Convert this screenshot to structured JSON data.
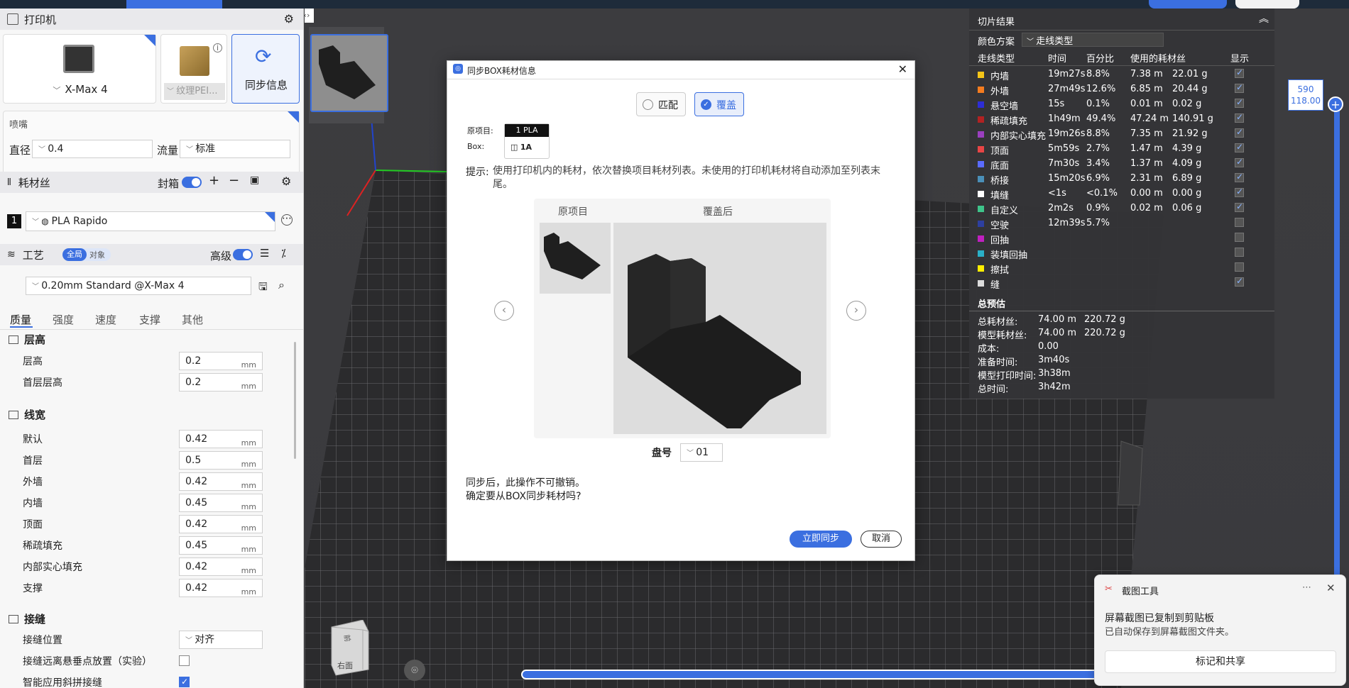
{
  "printer": {
    "title": "打印机",
    "model": "X-Max 4",
    "plate": "纹理PEI...",
    "sync_label": "同步信息"
  },
  "nozzle": {
    "title": "喷嘴",
    "diameter_label": "直径",
    "diameter_value": "0.4",
    "flow_label": "流量",
    "flow_value": "标准"
  },
  "filament": {
    "title": "耗材丝",
    "enclosure_label": "封箱",
    "slot": "1",
    "name": "PLA Rapido"
  },
  "process": {
    "title": "工艺",
    "global_label": "全局",
    "object_label": "对象",
    "advanced_label": "高级",
    "preset": "0.20mm Standard @X-Max 4",
    "tabs": [
      "质量",
      "强度",
      "速度",
      "支撑",
      "其他"
    ]
  },
  "quality": {
    "layer_group": "层高",
    "layer_height_label": "层高",
    "layer_height": "0.2",
    "first_layer_label": "首层层高",
    "first_layer": "0.2",
    "unit": "mm",
    "line_group": "线宽",
    "lines": [
      {
        "label": "默认",
        "value": "0.42"
      },
      {
        "label": "首层",
        "value": "0.5"
      },
      {
        "label": "外墙",
        "value": "0.42"
      },
      {
        "label": "内墙",
        "value": "0.45"
      },
      {
        "label": "顶面",
        "value": "0.42"
      },
      {
        "label": "稀疏填充",
        "value": "0.45"
      },
      {
        "label": "内部实心填充",
        "value": "0.42"
      },
      {
        "label": "支撑",
        "value": "0.42"
      }
    ],
    "seam_group": "接缝",
    "seam_pos_label": "接缝位置",
    "seam_pos_value": "对齐",
    "seam_far_label": "接缝远离悬垂点放置（实验）",
    "seam_scarf_label": "智能应用斜拼接缝"
  },
  "results": {
    "title": "切片结果",
    "scheme_label": "颜色方案",
    "scheme_value": "走线类型",
    "headers": [
      "走线类型",
      "时间",
      "百分比",
      "使用的耗材丝",
      "显示"
    ],
    "rows": [
      {
        "name": "内墙",
        "time": "19m27s",
        "pct": "8.8%",
        "len": "7.38 m",
        "wt": "22.01 g",
        "color": "#f5c518",
        "shown": true
      },
      {
        "name": "外墙",
        "time": "27m49s",
        "pct": "12.6%",
        "len": "6.85 m",
        "wt": "20.44 g",
        "color": "#f57c1f",
        "shown": true
      },
      {
        "name": "悬空墙",
        "time": "15s",
        "pct": "0.1%",
        "len": "0.01 m",
        "wt": "0.02 g",
        "color": "#2d2dd6",
        "shown": true
      },
      {
        "name": "稀疏填充",
        "time": "1h49m",
        "pct": "49.4%",
        "len": "47.24 m",
        "wt": "140.91 g",
        "color": "#b22222",
        "shown": true
      },
      {
        "name": "内部实心填充",
        "time": "19m26s",
        "pct": "8.8%",
        "len": "7.35 m",
        "wt": "21.92 g",
        "color": "#9b3fbf",
        "shown": true
      },
      {
        "name": "顶面",
        "time": "5m59s",
        "pct": "2.7%",
        "len": "1.47 m",
        "wt": "4.39 g",
        "color": "#e84545",
        "shown": true
      },
      {
        "name": "底面",
        "time": "7m30s",
        "pct": "3.4%",
        "len": "1.37 m",
        "wt": "4.09 g",
        "color": "#5a6bff",
        "shown": true
      },
      {
        "name": "桥接",
        "time": "15m20s",
        "pct": "6.9%",
        "len": "2.31 m",
        "wt": "6.89 g",
        "color": "#4a8fb8",
        "shown": true
      },
      {
        "name": "填缝",
        "time": "<1s",
        "pct": "<0.1%",
        "len": "0.00 m",
        "wt": "0.00 g",
        "color": "#ffffff",
        "shown": true
      },
      {
        "name": "自定义",
        "time": "2m2s",
        "pct": "0.9%",
        "len": "0.02 m",
        "wt": "0.06 g",
        "color": "#3ec48a",
        "shown": true
      },
      {
        "name": "空驶",
        "time": "12m39s",
        "pct": "5.7%",
        "len": "",
        "wt": "",
        "color": "#2d3fa0",
        "shown": false
      },
      {
        "name": "回抽",
        "time": "",
        "pct": "",
        "len": "",
        "wt": "",
        "color": "#c020c0",
        "shown": false
      },
      {
        "name": "装填回抽",
        "time": "",
        "pct": "",
        "len": "",
        "wt": "",
        "color": "#2ab0c8",
        "shown": false
      },
      {
        "name": "擦拭",
        "time": "",
        "pct": "",
        "len": "",
        "wt": "",
        "color": "#ffee00",
        "shown": false
      },
      {
        "name": "缝",
        "time": "",
        "pct": "",
        "len": "",
        "wt": "",
        "color": "#dddddd",
        "shown": true
      }
    ],
    "summary_title": "总预估",
    "summary": [
      {
        "label": "总耗材丝:",
        "v1": "74.00 m",
        "v2": "220.72 g"
      },
      {
        "label": "模型耗材丝:",
        "v1": "74.00 m",
        "v2": "220.72 g"
      },
      {
        "label": "成本:",
        "v1": "0.00",
        "v2": ""
      },
      {
        "label": "准备时间:",
        "v1": "3m40s",
        "v2": ""
      },
      {
        "label": "模型打印时间:",
        "v1": "3h38m",
        "v2": ""
      },
      {
        "label": "总时间:",
        "v1": "3h42m",
        "v2": ""
      }
    ]
  },
  "slider": {
    "top1": "590",
    "top2": "118.00"
  },
  "dialog": {
    "title": "同步BOX耗材信息",
    "match_label": "匹配",
    "overwrite_label": "覆盖",
    "original_label": "原项目:",
    "original_value": "1 PLA",
    "box_label": "Box:",
    "box_value": "1A",
    "hint_label": "提示:",
    "hint_text": "使用打印机内的耗材，依次替换项目耗材列表。未使用的打印机耗材将自动添加至列表末尾。",
    "col_original": "原项目",
    "col_after": "覆盖后",
    "tray_label": "盘号",
    "tray_value": "01",
    "warn1": "同步后，此操作不可撤销。",
    "warn2": "确定要从BOX同步耗材吗?",
    "sync_now": "立即同步",
    "cancel": "取消"
  },
  "nav_cube": {
    "top": "前",
    "front": "右面"
  },
  "toast": {
    "app": "截图工具",
    "title": "屏幕截图已复制到剪贴板",
    "body": "已自动保存到屏幕截图文件夹。",
    "action": "标记和共享"
  }
}
